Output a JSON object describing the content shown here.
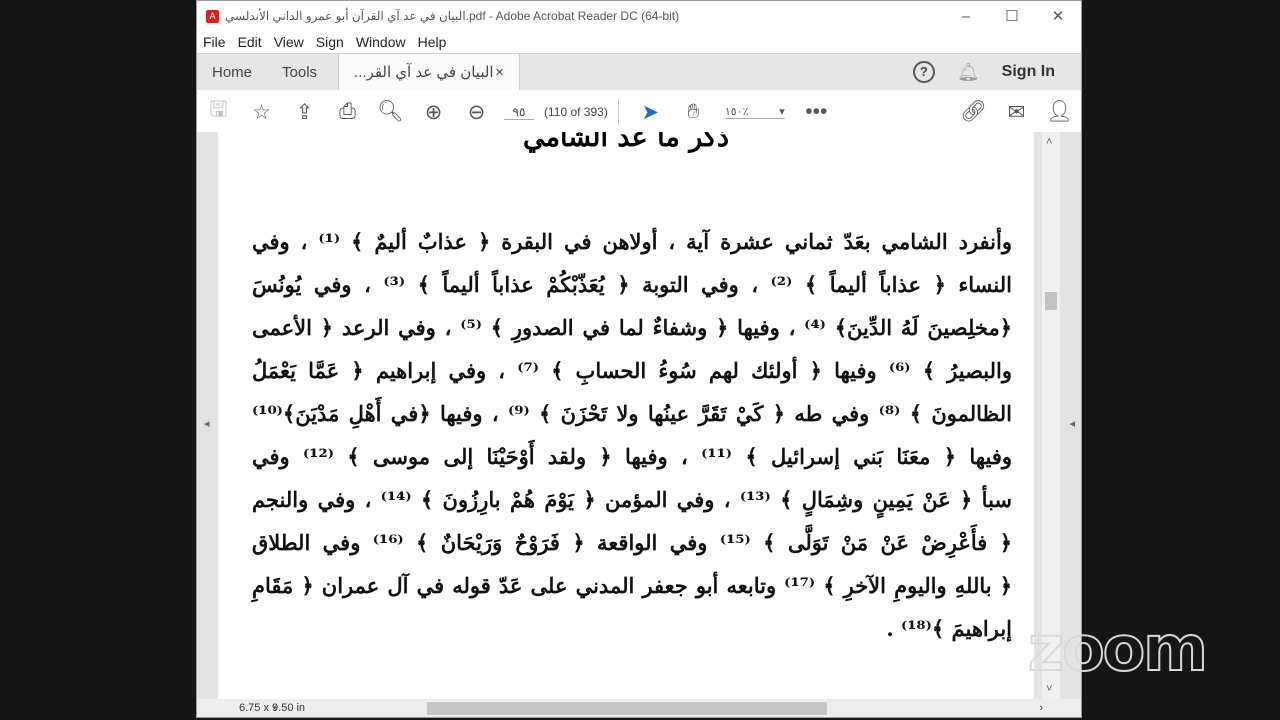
{
  "window": {
    "title": "البيان في عد آي القرآن أبو عمرو الداني الأندلسي.pdf - Adobe Acrobat Reader DC (64-bit)"
  },
  "menu": [
    "File",
    "Edit",
    "View",
    "Sign",
    "Window",
    "Help"
  ],
  "tabs": {
    "home": "Home",
    "tools": "Tools",
    "doc": "البيان في عد آي القر...",
    "close": "×",
    "sign_in": "Sign In"
  },
  "toolbar": {
    "page_input": "٩٥",
    "page_count": "(110 of 393)",
    "zoom": "١٥٠٪"
  },
  "document": {
    "heading": "ذكر ما عد الشامي",
    "lines": [
      "وأنفرد الشامي بعَدّ ثماني عشرة آية ، أولاهن في البقرة ﴿ عذابٌ أليمٌ ﴾ ⁽¹⁾ ، وفي",
      "النساء ﴿ عذاباً أليماً ﴾ ⁽²⁾ ، وفي التوبة ﴿ يُعَذّبْكُمْ عذاباً أليماً ﴾ ⁽³⁾ ، وفي يُونُسَ",
      "﴿مخلِصينَ لَهُ الدِّينَ﴾ ⁽⁴⁾ ، وفيها ﴿ وشفاءٌ لما في الصدورِ ﴾ ⁽⁵⁾ ، وفي الرعد ﴿ الأعمى",
      "والبصيرُ ﴾ ⁽⁶⁾ وفيها ﴿ أولئك لهم سُوءُ الحسابِ ﴾ ⁽⁷⁾ ، وفي إبراهيم ﴿ عَمَّا يَعْمَلُ",
      "الظالمونَ ﴾ ⁽⁸⁾ وفي طه ﴿ كَيْ تَقَرَّ عينُها ولا تَحْزَنَ ﴾ ⁽⁹⁾ ، وفيها ﴿في أَهْلِ مَدْيَنَ﴾⁽¹⁰⁾",
      "وفيها ﴿ معَنَا بَني إسرائيل ﴾ ⁽¹¹⁾ ، وفيها ﴿ ولقد أَوْحَيْنَا إلى موسى ﴾ ⁽¹²⁾ وفي",
      "سبأ ﴿ عَنْ يَمِينٍ وشِمَالٍ ﴾ ⁽¹³⁾ ، وفي المؤمن ﴿ يَوْمَ هُمْ بارِزُونَ ﴾ ⁽¹⁴⁾ ، وفي والنجم",
      "﴿ فأَعْرِضْ عَنْ مَنْ تَوَلَّى ﴾ ⁽¹⁵⁾ وفي الواقعة ﴿ فَرَوْحٌ وَرَيْحَانٌ ﴾ ⁽¹⁶⁾ وفي الطلاق",
      "﴿ باللهِ واليومِ الآخرِ ﴾ ⁽¹⁷⁾ وتابعه أبو جعفر المدني على عَدّ قوله في آل عمران ﴿ مَقَامِ",
      "إبراهيمَ ﴾⁽¹⁸⁾ ."
    ]
  },
  "status": {
    "page_size": "6.75 x 9.50 in"
  },
  "watermark": "zoom"
}
